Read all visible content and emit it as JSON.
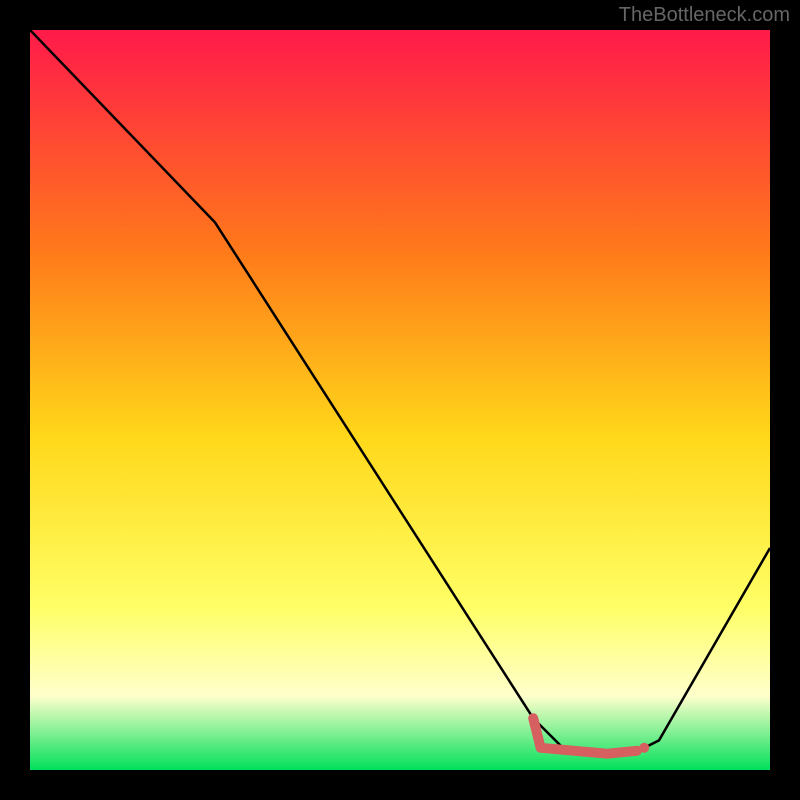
{
  "watermark": "TheBottleneck.com",
  "colors": {
    "gradient_top": "#ff1a4a",
    "gradient_mid1": "#ff7a1a",
    "gradient_mid2": "#ffd81a",
    "gradient_mid3": "#ffff66",
    "gradient_mid4": "#ffffcc",
    "gradient_bottom": "#00e05a",
    "line": "#000000",
    "marker": "#d66060"
  },
  "chart_data": {
    "type": "line",
    "title": "",
    "xlabel": "",
    "ylabel": "",
    "xlim": [
      0,
      100
    ],
    "ylim": [
      0,
      100
    ],
    "series": [
      {
        "name": "curve",
        "x": [
          0,
          25,
          68,
          72,
          78,
          82,
          85,
          100
        ],
        "values": [
          100,
          74,
          7,
          3,
          2,
          2.5,
          4,
          30
        ]
      }
    ],
    "markers": [
      {
        "name": "flat-segment",
        "type": "thick-line",
        "points": [
          [
            68,
            7
          ],
          [
            69,
            3
          ],
          [
            78,
            2.2
          ],
          [
            82,
            2.6
          ]
        ]
      },
      {
        "name": "dot-1",
        "type": "dot",
        "x": 80,
        "y": 2.4
      },
      {
        "name": "dot-2",
        "type": "dot",
        "x": 83,
        "y": 3.0
      }
    ]
  }
}
